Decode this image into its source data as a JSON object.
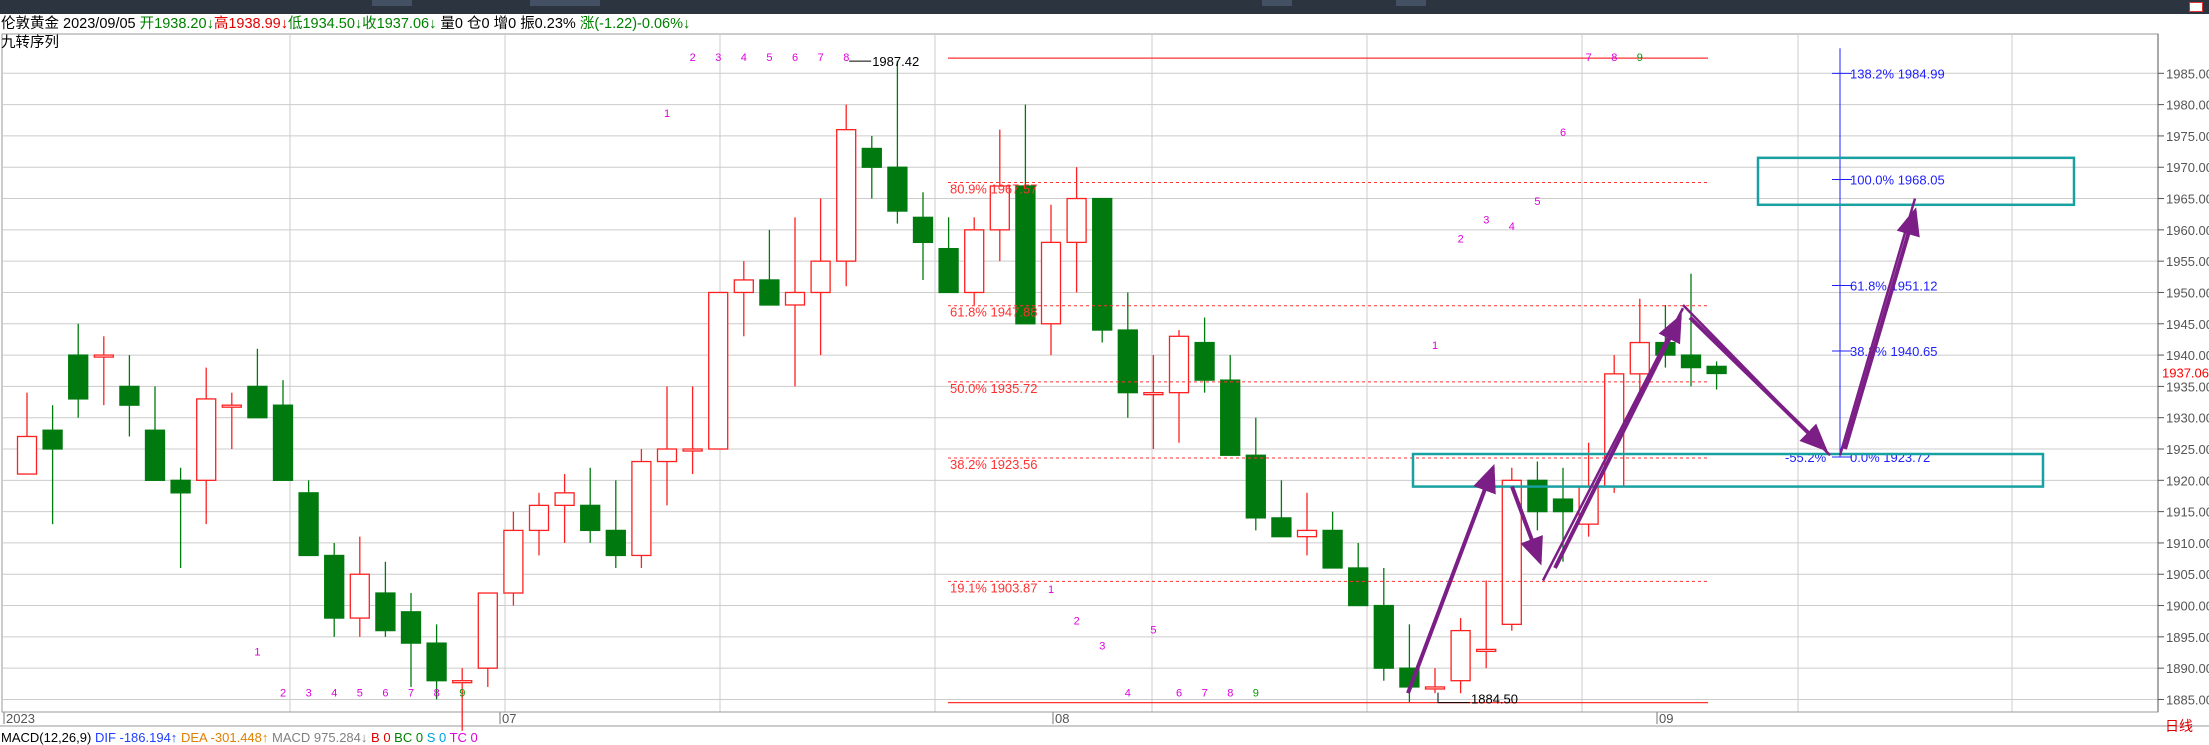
{
  "header": {
    "name": "伦敦黄金",
    "date": "2023/09/05",
    "open_label": "开",
    "open": "1938.20",
    "open_arrow": "↓",
    "high_label": "高",
    "high": "1938.99",
    "high_arrow": "↓",
    "low_label": "低",
    "low": "1934.50",
    "low_arrow": "↓",
    "close_label": "收",
    "close": "1937.06",
    "close_arrow": "↓",
    "volume": "量0",
    "position": "仓0",
    "increase": "增0",
    "amplitude": "振0.23%",
    "change": "涨(-1.22)-0.06%",
    "change_arrow": "↓"
  },
  "indicator_title": "九转序列",
  "period_tab": "日线",
  "macd_line": {
    "name": "MACD(12,26,9)",
    "dif": "DIF -186.194↑",
    "dea": "DEA -301.448↑",
    "macd": "MACD 975.284↓",
    "b": "B 0",
    "bc": "BC 0",
    "s": "S 0",
    "tc": "TC 0"
  },
  "colors": {
    "up": "#ff2020",
    "down": "#007a0e",
    "fib": "#ff3030",
    "fib_blue": "#2020ff",
    "arrow": "#7b1f86",
    "box": "#19a0a0",
    "seq_magenta": "#dd00dd",
    "seq_green": "#009900",
    "price_tag": "#ff0000"
  },
  "chart_data": {
    "type": "candlestick",
    "symbol": "伦敦黄金",
    "period": "日线",
    "ylim": [
      1883,
      1990
    ],
    "y_ticks": [
      "1985.00",
      "1980.00",
      "1975.00",
      "1970.00",
      "1965.00",
      "1960.00",
      "1955.00",
      "1950.00",
      "1945.00",
      "1940.00",
      "1935.00",
      "1930.00",
      "1925.00",
      "1920.00",
      "1915.00",
      "1910.00",
      "1905.00",
      "1900.00",
      "1895.00",
      "1890.00",
      "1885.00"
    ],
    "x_labels": [
      "2023",
      "07",
      "08",
      "09"
    ],
    "last_price": "1937.06",
    "candles": [
      {
        "o": 1921.0,
        "h": 1934.0,
        "l": 1921.0,
        "c": 1927.0
      },
      {
        "o": 1928.0,
        "h": 1932.0,
        "l": 1913.0,
        "c": 1925.0
      },
      {
        "o": 1940.0,
        "h": 1945.0,
        "l": 1930.0,
        "c": 1933.0
      },
      {
        "o": 1940.0,
        "h": 1943.0,
        "l": 1932.0,
        "c": 1940.0
      },
      {
        "o": 1935.0,
        "h": 1940.0,
        "l": 1927.0,
        "c": 1932.0
      },
      {
        "o": 1928.0,
        "h": 1935.0,
        "l": 1922.0,
        "c": 1920.0
      },
      {
        "o": 1920.0,
        "h": 1922.0,
        "l": 1906.0,
        "c": 1918.0
      },
      {
        "o": 1920.0,
        "h": 1938.0,
        "l": 1913.0,
        "c": 1933.0
      },
      {
        "o": 1932.0,
        "h": 1934.0,
        "l": 1925.0,
        "c": 1932.0
      },
      {
        "o": 1935.0,
        "h": 1941.0,
        "l": 1930.0,
        "c": 1930.0
      },
      {
        "o": 1932.0,
        "h": 1936.0,
        "l": 1920.0,
        "c": 1920.0
      },
      {
        "o": 1918.0,
        "h": 1920.0,
        "l": 1910.0,
        "c": 1908.0
      },
      {
        "o": 1908.0,
        "h": 1910.0,
        "l": 1895.0,
        "c": 1898.0
      },
      {
        "o": 1898.0,
        "h": 1911.0,
        "l": 1895.0,
        "c": 1905.0
      },
      {
        "o": 1902.0,
        "h": 1907.0,
        "l": 1895.0,
        "c": 1896.0
      },
      {
        "o": 1899.0,
        "h": 1902.0,
        "l": 1887.0,
        "c": 1894.0
      },
      {
        "o": 1894.0,
        "h": 1897.0,
        "l": 1885.0,
        "c": 1888.0
      },
      {
        "o": 1888.0,
        "h": 1890.0,
        "l": 1880.0,
        "c": 1888.0
      },
      {
        "o": 1890.0,
        "h": 1902.0,
        "l": 1887.0,
        "c": 1902.0
      },
      {
        "o": 1902.0,
        "h": 1915.0,
        "l": 1900.0,
        "c": 1912.0
      },
      {
        "o": 1912.0,
        "h": 1918.0,
        "l": 1908.0,
        "c": 1916.0
      },
      {
        "o": 1916.0,
        "h": 1921.0,
        "l": 1910.0,
        "c": 1918.0
      },
      {
        "o": 1916.0,
        "h": 1922.0,
        "l": 1910.0,
        "c": 1912.0
      },
      {
        "o": 1912.0,
        "h": 1920.0,
        "l": 1906.0,
        "c": 1908.0
      },
      {
        "o": 1908.0,
        "h": 1925.0,
        "l": 1906.0,
        "c": 1923.0
      },
      {
        "o": 1923.0,
        "h": 1935.0,
        "l": 1916.0,
        "c": 1925.0
      },
      {
        "o": 1925.0,
        "h": 1935.0,
        "l": 1921.0,
        "c": 1925.0
      },
      {
        "o": 1925.0,
        "h": 1950.0,
        "l": 1925.0,
        "c": 1950.0
      },
      {
        "o": 1950.0,
        "h": 1955.0,
        "l": 1943.0,
        "c": 1952.0
      },
      {
        "o": 1952.0,
        "h": 1960.0,
        "l": 1948.0,
        "c": 1948.0
      },
      {
        "o": 1948.0,
        "h": 1962.0,
        "l": 1935.0,
        "c": 1950.0
      },
      {
        "o": 1950.0,
        "h": 1965.0,
        "l": 1940.0,
        "c": 1955.0
      },
      {
        "o": 1955.0,
        "h": 1980.0,
        "l": 1951.0,
        "c": 1976.0
      },
      {
        "o": 1973.0,
        "h": 1975.0,
        "l": 1965.0,
        "c": 1970.0
      },
      {
        "o": 1970.0,
        "h": 1987.0,
        "l": 1961.0,
        "c": 1963.0
      },
      {
        "o": 1962.0,
        "h": 1966.0,
        "l": 1952.0,
        "c": 1958.0
      },
      {
        "o": 1957.0,
        "h": 1962.0,
        "l": 1950.0,
        "c": 1950.0
      },
      {
        "o": 1950.0,
        "h": 1962.0,
        "l": 1948.0,
        "c": 1960.0
      },
      {
        "o": 1960.0,
        "h": 1976.0,
        "l": 1955.0,
        "c": 1967.0
      },
      {
        "o": 1967.0,
        "h": 1980.0,
        "l": 1945.0,
        "c": 1945.0
      },
      {
        "o": 1945.0,
        "h": 1964.0,
        "l": 1940.0,
        "c": 1958.0
      },
      {
        "o": 1958.0,
        "h": 1970.0,
        "l": 1950.0,
        "c": 1965.0
      },
      {
        "o": 1965.0,
        "h": 1965.0,
        "l": 1942.0,
        "c": 1944.0
      },
      {
        "o": 1944.0,
        "h": 1950.0,
        "l": 1930.0,
        "c": 1934.0
      },
      {
        "o": 1934.0,
        "h": 1940.0,
        "l": 1925.0,
        "c": 1934.0
      },
      {
        "o": 1934.0,
        "h": 1944.0,
        "l": 1926.0,
        "c": 1943.0
      },
      {
        "o": 1942.0,
        "h": 1946.0,
        "l": 1934.0,
        "c": 1936.0
      },
      {
        "o": 1936.0,
        "h": 1940.0,
        "l": 1924.0,
        "c": 1924.0
      },
      {
        "o": 1924.0,
        "h": 1930.0,
        "l": 1912.0,
        "c": 1914.0
      },
      {
        "o": 1914.0,
        "h": 1920.0,
        "l": 1912.0,
        "c": 1911.0
      },
      {
        "o": 1911.0,
        "h": 1918.0,
        "l": 1908.0,
        "c": 1912.0
      },
      {
        "o": 1912.0,
        "h": 1915.0,
        "l": 1906.0,
        "c": 1906.0
      },
      {
        "o": 1906.0,
        "h": 1910.0,
        "l": 1900.0,
        "c": 1900.0
      },
      {
        "o": 1900.0,
        "h": 1906.0,
        "l": 1888.0,
        "c": 1890.0
      },
      {
        "o": 1890.0,
        "h": 1897.0,
        "l": 1884.5,
        "c": 1887.0
      },
      {
        "o": 1887.0,
        "h": 1890.0,
        "l": 1886.0,
        "c": 1887.0
      },
      {
        "o": 1888.0,
        "h": 1898.0,
        "l": 1886.0,
        "c": 1896.0
      },
      {
        "o": 1893.0,
        "h": 1904.0,
        "l": 1890.0,
        "c": 1893.0
      },
      {
        "o": 1897.0,
        "h": 1922.0,
        "l": 1896.0,
        "c": 1920.0
      },
      {
        "o": 1920.0,
        "h": 1923.0,
        "l": 1912.0,
        "c": 1915.0
      },
      {
        "o": 1917.0,
        "h": 1922.0,
        "l": 1907.0,
        "c": 1915.0
      },
      {
        "o": 1913.0,
        "h": 1926.0,
        "l": 1911.0,
        "c": 1919.0
      },
      {
        "o": 1919.0,
        "h": 1940.0,
        "l": 1918.0,
        "c": 1937.0
      },
      {
        "o": 1937.0,
        "h": 1949.0,
        "l": 1934.0,
        "c": 1942.0
      },
      {
        "o": 1942.0,
        "h": 1948.0,
        "l": 1938.0,
        "c": 1940.0
      },
      {
        "o": 1940.0,
        "h": 1953.0,
        "l": 1935.0,
        "c": 1938.0
      },
      {
        "o": 1938.2,
        "h": 1938.99,
        "l": 1934.5,
        "c": 1937.06
      }
    ],
    "sequence_marks": [
      {
        "i": 26,
        "v": 1987.0,
        "text": "2",
        "color": "m"
      },
      {
        "i": 27,
        "v": 1987.0,
        "text": "3",
        "color": "m"
      },
      {
        "i": 28,
        "v": 1987.0,
        "text": "4",
        "color": "m"
      },
      {
        "i": 29,
        "v": 1987.0,
        "text": "5",
        "color": "m"
      },
      {
        "i": 30,
        "v": 1987.0,
        "text": "6",
        "color": "m"
      },
      {
        "i": 31,
        "v": 1987.0,
        "text": "7",
        "color": "m"
      },
      {
        "i": 32,
        "v": 1987.0,
        "text": "8",
        "color": "m"
      },
      {
        "i": 25,
        "v": 1978.0,
        "text": "1",
        "color": "m"
      },
      {
        "i": 9,
        "v": 1892.0,
        "text": "1",
        "color": "m"
      },
      {
        "i": 10,
        "v": 1885.5,
        "text": "2",
        "color": "m"
      },
      {
        "i": 11,
        "v": 1885.5,
        "text": "3",
        "color": "m"
      },
      {
        "i": 12,
        "v": 1885.5,
        "text": "4",
        "color": "m"
      },
      {
        "i": 13,
        "v": 1885.5,
        "text": "5",
        "color": "m"
      },
      {
        "i": 14,
        "v": 1885.5,
        "text": "6",
        "color": "m"
      },
      {
        "i": 15,
        "v": 1885.5,
        "text": "7",
        "color": "m"
      },
      {
        "i": 16,
        "v": 1885.5,
        "text": "8",
        "color": "m"
      },
      {
        "i": 17,
        "v": 1885.5,
        "text": "9",
        "color": "g"
      },
      {
        "i": 40,
        "v": 1902.0,
        "text": "1",
        "color": "m"
      },
      {
        "i": 41,
        "v": 1897.0,
        "text": "2",
        "color": "m"
      },
      {
        "i": 42,
        "v": 1893.0,
        "text": "3",
        "color": "m"
      },
      {
        "i": 43,
        "v": 1885.5,
        "text": "4",
        "color": "m"
      },
      {
        "i": 44,
        "v": 1895.5,
        "text": "5",
        "color": "m"
      },
      {
        "i": 45,
        "v": 1885.5,
        "text": "6",
        "color": "m"
      },
      {
        "i": 46,
        "v": 1885.5,
        "text": "7",
        "color": "m"
      },
      {
        "i": 47,
        "v": 1885.5,
        "text": "8",
        "color": "m"
      },
      {
        "i": 48,
        "v": 1885.5,
        "text": "9",
        "color": "g"
      },
      {
        "i": 55,
        "v": 1941.0,
        "text": "1",
        "color": "m"
      },
      {
        "i": 56,
        "v": 1958.0,
        "text": "2",
        "color": "m"
      },
      {
        "i": 57,
        "v": 1961.0,
        "text": "3",
        "color": "m"
      },
      {
        "i": 58,
        "v": 1960.0,
        "text": "4",
        "color": "m"
      },
      {
        "i": 59,
        "v": 1964.0,
        "text": "5",
        "color": "m"
      },
      {
        "i": 60,
        "v": 1975.0,
        "text": "6",
        "color": "m"
      },
      {
        "i": 61,
        "v": 1987.0,
        "text": "7",
        "color": "m"
      },
      {
        "i": 62,
        "v": 1987.0,
        "text": "8",
        "color": "m"
      },
      {
        "i": 63,
        "v": 1987.0,
        "text": "9",
        "color": "g"
      }
    ],
    "fib_retracement": {
      "high_label": "1987.42",
      "low_label": "1884.50",
      "high": 1987.42,
      "low": 1884.5,
      "levels": [
        {
          "label": "80.9% 1967.57",
          "v": 1967.57
        },
        {
          "label": "61.8% 1947.88",
          "v": 1947.88
        },
        {
          "label": "50.0% 1935.72",
          "v": 1935.72
        },
        {
          "label": "38.2% 1923.56",
          "v": 1923.56
        },
        {
          "label": "19.1% 1903.87",
          "v": 1903.87
        }
      ]
    },
    "fib_extension": {
      "levels": [
        {
          "label": "138.2% 1984.99",
          "v": 1984.99
        },
        {
          "label": "100.0% 1968.05",
          "v": 1968.05
        },
        {
          "label": "61.8% 1951.12",
          "v": 1951.12
        },
        {
          "label": "38.2% 1940.65",
          "v": 1940.65
        },
        {
          "label": "0.0% 1923.72",
          "v": 1923.72
        }
      ],
      "extra_label": "-55.2%"
    }
  }
}
